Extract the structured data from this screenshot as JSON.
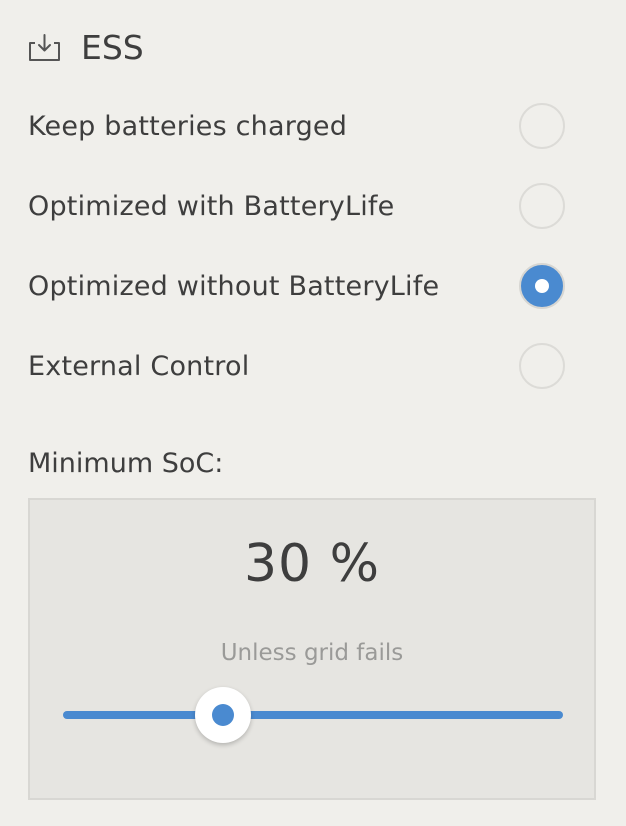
{
  "header": {
    "icon": "download-tray-icon",
    "title": "ESS"
  },
  "modes": [
    {
      "label": "Keep batteries charged",
      "selected": false
    },
    {
      "label": "Optimized with BatteryLife",
      "selected": false
    },
    {
      "label": "Optimized without BatteryLife",
      "selected": true
    },
    {
      "label": "External Control",
      "selected": false
    }
  ],
  "soc": {
    "label": "Minimum SoC:",
    "value_text": "30 %",
    "note": "Unless grid fails",
    "slider_fraction": 0.32
  },
  "colors": {
    "accent": "#4a8ad0",
    "background": "#f0efeb",
    "panel": "#e6e5e1"
  }
}
